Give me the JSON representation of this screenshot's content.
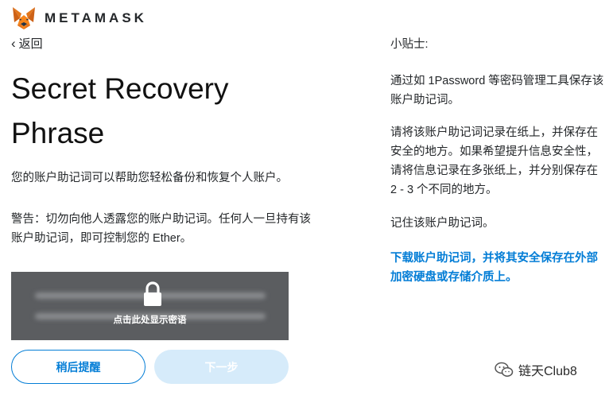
{
  "brand": {
    "name": "METAMASK"
  },
  "nav": {
    "back_label": "返回"
  },
  "main": {
    "title": "Secret Recovery Phrase",
    "description": "您的账户助记词可以帮助您轻松备份和恢复个人账户。",
    "warning": "警告：切勿向他人透露您的账户助记词。任何人一旦持有该账户助记词，即可控制您的 Ether。",
    "reveal_label": "点击此处显示密语",
    "remind_later_label": "稍后提醒",
    "next_label": "下一步"
  },
  "tips": {
    "heading": "小贴士:",
    "items": [
      "通过如 1Password 等密码管理工具保存该账户助记词。",
      "请将该账户助记词记录在纸上，并保存在安全的地方。如果希望提升信息安全性，请将信息记录在多张纸上，并分别保存在 2 - 3 个不同的地方。",
      "记住该账户助记词。"
    ],
    "download_link": "下载账户助记词，并将其安全保存在外部加密硬盘或存储介质上。"
  },
  "watermark": {
    "text": "链天Club8"
  },
  "colors": {
    "accent": "#037dd6",
    "disabled_button": "#d6ebfa",
    "reveal_overlay": "#5b5d60"
  },
  "icons": {
    "logo": "metamask-fox-icon",
    "back": "chevron-left-icon",
    "lock": "lock-icon",
    "watermark": "wechat-icon"
  }
}
